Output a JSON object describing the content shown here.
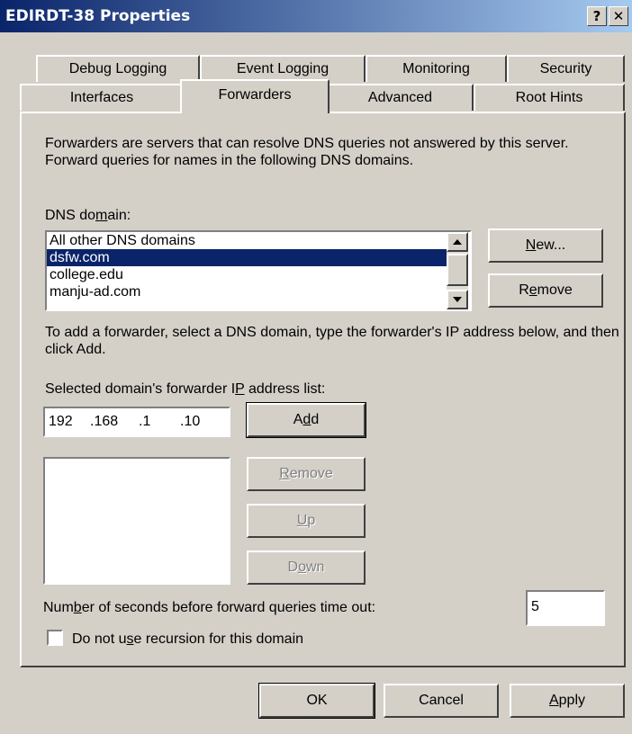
{
  "window": {
    "title": "EDIRDT-38 Properties",
    "help_button": "?",
    "close_button": "✕"
  },
  "tabs_row_back": [
    "Debug Logging",
    "Event Logging",
    "Monitoring",
    "Security"
  ],
  "tabs_row_front": [
    "Interfaces",
    "Forwarders",
    "Advanced",
    "Root Hints"
  ],
  "active_tab": "Forwarders",
  "description": "Forwarders are servers that can resolve DNS queries not answered by this server. Forward queries for names in the following DNS domains.",
  "dns_domain": {
    "label_pre": "DNS do",
    "label_key": "m",
    "label_post": "ain:",
    "items": [
      "All other DNS domains",
      "dsfw.com",
      "college.edu",
      "manju-ad.com"
    ],
    "selected": "dsfw.com",
    "new_button": {
      "key": "N",
      "rest": "ew..."
    },
    "remove_button": {
      "pre": "R",
      "key": "e",
      "rest": "move"
    }
  },
  "instruction": "To add a forwarder, select a DNS domain, type the forwarder's IP address below, and then click Add.",
  "ip_list": {
    "label_pre": "Selected domain's forwarder I",
    "label_key": "P",
    "label_post": " address list:",
    "ip_octets": [
      "192",
      ".168",
      ".1",
      ".10"
    ],
    "add_button": {
      "pre": "A",
      "key": "d",
      "rest": "d"
    },
    "remove_button": {
      "key": "R",
      "rest": "emove"
    },
    "up_button": {
      "key": "U",
      "rest": "p"
    },
    "down_button": {
      "pre": "D",
      "key": "o",
      "rest": "wn"
    }
  },
  "timeout": {
    "label_pre": "Num",
    "label_key": "b",
    "label_post": "er of seconds before forward queries time out:",
    "value": "5"
  },
  "recursion": {
    "label_pre": "Do not u",
    "label_key": "s",
    "label_post": "e recursion for this domain",
    "checked": false
  },
  "footer": {
    "ok": "OK",
    "cancel": "Cancel",
    "apply_key": "A",
    "apply_rest": "pply"
  },
  "colors": {
    "title_start": "#0a246a",
    "title_end": "#a6caf0",
    "selection": "#0a246a",
    "face": "#d4d0c8"
  }
}
